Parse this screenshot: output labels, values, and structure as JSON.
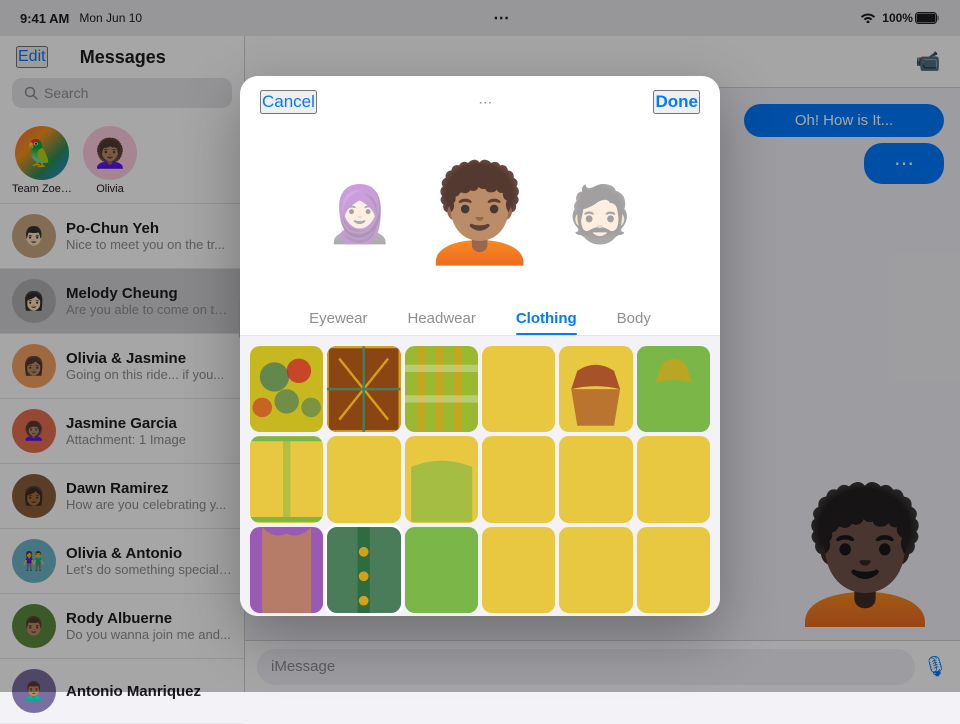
{
  "statusBar": {
    "time": "9:41 AM",
    "date": "Mon Jun 10",
    "battery": "100%",
    "wifi": "WiFi"
  },
  "sidebar": {
    "editLabel": "Edit",
    "title": "Messages",
    "searchPlaceholder": "Search",
    "pinnedConversations": [
      {
        "id": "team-zoetrope",
        "name": "Team Zoetrope",
        "avatarEmoji": "🦜",
        "avatarBg": "#ff6b35"
      },
      {
        "id": "olivia",
        "name": "Olivia",
        "avatarEmoji": "👩🏽‍🦱",
        "avatarBg": "#ffb3c6"
      }
    ],
    "conversations": [
      {
        "id": "po-chun",
        "name": "Po-Chun Yeh",
        "preview": "Nice to meet you on the tr...",
        "avatarEmoji": "👨🏻",
        "avatarBg": "#c8a882",
        "unread": false
      },
      {
        "id": "melody",
        "name": "Melody Cheung",
        "preview": "Are you able to come on th...",
        "avatarEmoji": "👩🏻",
        "avatarBg": "#b0b0b0",
        "unread": false,
        "selected": true
      },
      {
        "id": "olivia-jasmine",
        "name": "Olivia & Jasmine",
        "preview": "Going on this ride... if you...",
        "avatarEmoji": "👩🏽",
        "avatarBg": "#f4a261",
        "unread": false
      },
      {
        "id": "jasmine",
        "name": "Jasmine Garcia",
        "preview": "Attachment: 1 Image",
        "avatarEmoji": "👩🏽‍🦱",
        "avatarBg": "#e76f51",
        "unread": false
      },
      {
        "id": "dawn",
        "name": "Dawn Ramirez",
        "preview": "How are you celebrating y...",
        "avatarEmoji": "👩🏾",
        "avatarBg": "#8b5e3c",
        "unread": false
      },
      {
        "id": "olivia-antonio",
        "name": "Olivia & Antonio",
        "preview": "Let's do something special dawn at the next meeting r...",
        "avatarEmoji": "👫",
        "avatarBg": "#6db5ca",
        "unread": false
      },
      {
        "id": "rody",
        "name": "Rody Albuerne",
        "preview": "Do you wanna join me and...",
        "avatarEmoji": "👨🏽",
        "avatarBg": "#5c8a3c",
        "unread": false
      },
      {
        "id": "antonio",
        "name": "Antonio Manriquez",
        "preview": "",
        "avatarEmoji": "👨🏽‍🦱",
        "avatarBg": "#7b6ea0",
        "unread": false
      }
    ]
  },
  "chat": {
    "bubbles": [
      {
        "text": "Oh! How is It...",
        "type": "outgoing"
      },
      {
        "text": "...",
        "type": "outgoing"
      }
    ],
    "inputPlaceholder": "iMessage",
    "videoCallIcon": "📹"
  },
  "modal": {
    "cancelLabel": "Cancel",
    "doneLabel": "Done",
    "tabs": [
      {
        "id": "eyewear",
        "label": "Eyewear",
        "active": false
      },
      {
        "id": "headwear",
        "label": "Headwear",
        "active": false
      },
      {
        "id": "clothing",
        "label": "Clothing",
        "active": true
      },
      {
        "id": "body",
        "label": "Body",
        "active": false
      }
    ],
    "clothingItems": [
      {
        "id": 1,
        "colors": [
          "#d4a017",
          "#4a7c59",
          "#c62a2a"
        ],
        "selected": false
      },
      {
        "id": 2,
        "colors": [
          "#8b4513",
          "#d4a017",
          "#4a7c59"
        ],
        "selected": false
      },
      {
        "id": 3,
        "colors": [
          "#d4a017",
          "#7ab648",
          "#c8b560"
        ],
        "selected": false
      },
      {
        "id": 4,
        "colors": [
          "#e8c840",
          "#e8c840",
          "#c9a82c"
        ],
        "selected": false
      },
      {
        "id": 5,
        "colors": [
          "#8b2020",
          "#d4a017",
          "#4a1a8b"
        ],
        "selected": false
      },
      {
        "id": 6,
        "colors": [
          "#7ab648",
          "#d4a017",
          "#5a8c38"
        ],
        "selected": false
      },
      {
        "id": 7,
        "colors": [
          "#d4a017",
          "#6aaa32",
          "#b89010"
        ],
        "selected": false
      },
      {
        "id": 8,
        "colors": [
          "#e8c840",
          "#e8c840",
          "#c9a82c"
        ],
        "selected": false
      },
      {
        "id": 9,
        "colors": [
          "#e8c840",
          "#7ab648",
          "#c9a82c"
        ],
        "selected": false
      },
      {
        "id": 10,
        "colors": [
          "#e8c840",
          "#e8c840",
          "#c9a82c"
        ],
        "selected": false
      },
      {
        "id": 11,
        "colors": [
          "#e8c840",
          "#e8c840",
          "#c9a82c"
        ],
        "selected": false
      },
      {
        "id": 12,
        "colors": [
          "#e8c840",
          "#e8c840",
          "#c9a82c"
        ],
        "selected": false
      },
      {
        "id": 13,
        "colors": [
          "#9b59b6",
          "#d4a017",
          "#7d3c98"
        ],
        "selected": false
      },
      {
        "id": 14,
        "colors": [
          "#4a7c59",
          "#d4a017",
          "#2e6b3e"
        ],
        "selected": true
      },
      {
        "id": 15,
        "colors": [
          "#7ab648",
          "#e8c840",
          "#5a8c38"
        ],
        "selected": false
      },
      {
        "id": 16,
        "colors": [
          "#e8c840",
          "#e8c840",
          "#c9a82c"
        ],
        "selected": false
      },
      {
        "id": 17,
        "colors": [
          "#e8c840",
          "#e8c840",
          "#c9a82c"
        ],
        "selected": false
      },
      {
        "id": 18,
        "colors": [
          "#e8c840",
          "#e8c840",
          "#c9a82c"
        ],
        "selected": false
      },
      {
        "id": 19,
        "colors": [
          "#4a7c59",
          "#e8c840",
          "#2e6b3e"
        ],
        "selected": false
      },
      {
        "id": 20,
        "colors": [
          "#e8c840",
          "#e8c840",
          "#c9a82c"
        ],
        "selected": false
      },
      {
        "id": 21,
        "colors": [
          "#e8c840",
          "#e8c840",
          "#c9a82c"
        ],
        "selected": false
      },
      {
        "id": 22,
        "colors": [
          "#e8c840",
          "#e8c840",
          "#c9a82c"
        ],
        "selected": false
      },
      {
        "id": 23,
        "colors": [
          "#e8c840",
          "#7ab648",
          "#c9a82c"
        ],
        "selected": false
      },
      {
        "id": 24,
        "colors": [
          "#e8c840",
          "#e8c840",
          "#c9a82c"
        ],
        "selected": false
      }
    ]
  }
}
